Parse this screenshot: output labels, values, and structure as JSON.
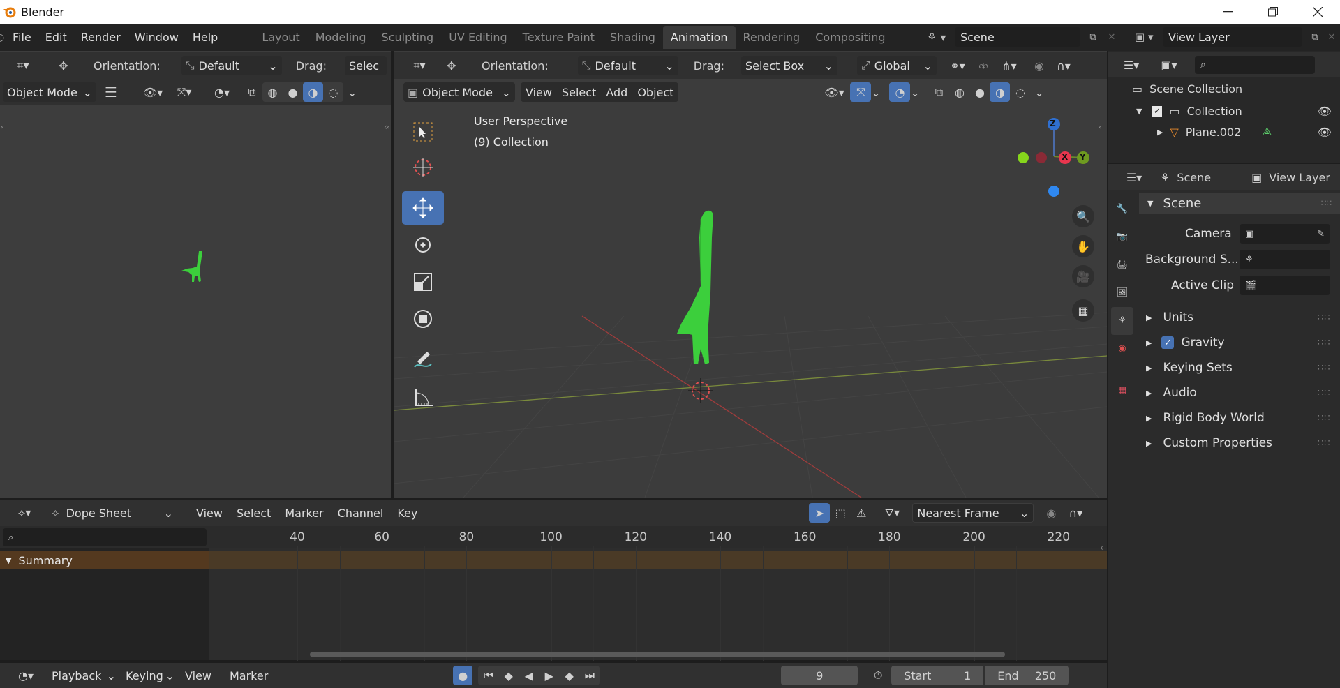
{
  "app": {
    "title": "Blender"
  },
  "topbar": {
    "menus": [
      "File",
      "Edit",
      "Render",
      "Window",
      "Help"
    ],
    "workspaces": [
      "Layout",
      "Modeling",
      "Sculpting",
      "UV Editing",
      "Texture Paint",
      "Shading",
      "Animation",
      "Rendering",
      "Compositing"
    ],
    "active_workspace": "Animation",
    "scene": "Scene",
    "view_layer": "View Layer"
  },
  "left_view": {
    "orientation_label": "Orientation:",
    "orientation": "Default",
    "drag_label": "Drag:",
    "drag": "Selec",
    "mode": "Object Mode"
  },
  "main_view": {
    "orientation_label": "Orientation:",
    "orientation": "Default",
    "drag_label": "Drag:",
    "drag": "Select Box",
    "transform": "Global",
    "mode": "Object Mode",
    "menus": [
      "View",
      "Select",
      "Add",
      "Object"
    ],
    "overlay_title": "User Perspective",
    "overlay_sub": "(9) Collection",
    "gizmo": {
      "z": "Z",
      "x": "X",
      "y": "Y"
    }
  },
  "outliner": {
    "root": "Scene Collection",
    "collection": "Collection",
    "object": "Plane.002"
  },
  "properties": {
    "scene_tab": "Scene",
    "viewlayer_tab": "View Layer",
    "section": "Scene",
    "camera_label": "Camera",
    "background_label": "Background S...",
    "clip_label": "Active Clip",
    "panels": [
      "Units",
      "Gravity",
      "Keying Sets",
      "Audio",
      "Rigid Body World",
      "Custom Properties"
    ],
    "gravity_checked": true
  },
  "dopesheet": {
    "mode": "Dope Sheet",
    "menus": [
      "View",
      "Select",
      "Marker",
      "Channel",
      "Key"
    ],
    "snap": "Nearest Frame",
    "summary": "Summary",
    "ticks": [
      "40",
      "60",
      "80",
      "100",
      "120",
      "140",
      "160",
      "180",
      "200",
      "220"
    ]
  },
  "timeline": {
    "menus": [
      "Playback",
      "Keying",
      "View",
      "Marker"
    ],
    "current_frame": "9",
    "start_label": "Start",
    "start": "1",
    "end_label": "End",
    "end": "250"
  },
  "colors": {
    "accent": "#4772b3",
    "object_green": "#3ccf3c",
    "summary_bg": "#54391f",
    "header": "#303030"
  }
}
